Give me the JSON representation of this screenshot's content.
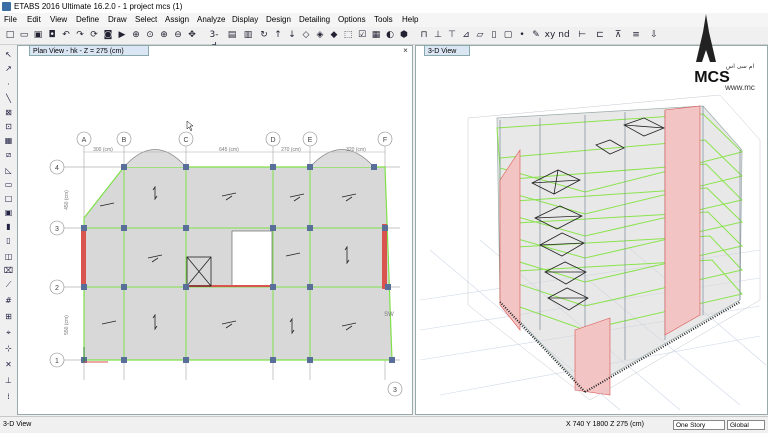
{
  "window": {
    "title": "ETABS 2016 Ultimate 16.2.0 - 1 project mcs (1)"
  },
  "menu": [
    "File",
    "Edit",
    "View",
    "Define",
    "Draw",
    "Select",
    "Assign",
    "Analyze",
    "Display",
    "Design",
    "Detailing",
    "Options",
    "Tools",
    "Help"
  ],
  "toolbar": {
    "view_3d_label": "3-d",
    "xy_label": "xy",
    "nd_label": "nd"
  },
  "panes": {
    "plan": {
      "tab": "Plan View - hk - Z = 275 (cm)"
    },
    "view3d": {
      "tab": "3-D View"
    }
  },
  "plan": {
    "grid_x": [
      "A",
      "B",
      "C",
      "D",
      "E",
      "F"
    ],
    "grid_y": [
      "4",
      "3",
      "2",
      "1"
    ],
    "grid_extra": "3",
    "dims_top": [
      "300 (cm)",
      "645 (cm)",
      "270 (cm)",
      "320 (cm)"
    ],
    "dims_left": [
      "450 (cm)",
      "550 (cm)"
    ],
    "wall_label": "SW"
  },
  "watermark": {
    "logo": "MCS",
    "persian": "ام سی اس",
    "url": "www.mc"
  },
  "status": {
    "left": "3-D View",
    "coords": "X 740  Y 1800  Z 275 (cm)",
    "story_select": "One Story",
    "coord_select": "Global"
  },
  "colors": {
    "slab": "#d8d8d8",
    "beam": "#7fe04a",
    "column": "#5a6e9a",
    "wall": "#d9534f",
    "grid": "#999999"
  }
}
